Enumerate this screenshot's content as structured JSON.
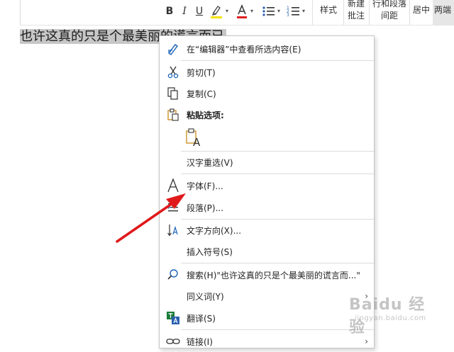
{
  "toolbar": {
    "bold_label": "B",
    "italic_label": "I",
    "underline_label": "U",
    "highlight_color": "#f5e211",
    "font_color": "#e02020",
    "style_label": "样式",
    "new_comment_line1": "新建",
    "new_comment_line2": "批注",
    "line_spacing_line1": "行和段落",
    "line_spacing_line2": "间距",
    "center_label": "居中",
    "justify_label": "两端"
  },
  "document": {
    "selected_text": "也许这真的只是个最美丽的谎言而已"
  },
  "context_menu": {
    "items": [
      {
        "label": "在“编辑器”中查看所选内容(E)",
        "icon": "editor-pen-icon"
      },
      {
        "label": "剪切(T)",
        "icon": "scissors-icon"
      },
      {
        "label": "复制(C)",
        "icon": "copy-icon"
      },
      {
        "label": "粘贴选项:",
        "icon": "clipboard-icon"
      },
      {
        "label": "汉字重选(V)",
        "icon": ""
      },
      {
        "label": "字体(F)...",
        "icon": "font-icon"
      },
      {
        "label": "段落(P)...",
        "icon": "paragraph-icon"
      },
      {
        "label": "文字方向(X)...",
        "icon": "text-direction-icon"
      },
      {
        "label": "插入符号(S)",
        "icon": ""
      },
      {
        "label": "搜索(H)\"也许这真的只是个最美丽的谎言而...\"",
        "icon": "search-icon"
      },
      {
        "label": "同义词(Y)",
        "icon": "",
        "submenu": true
      },
      {
        "label": "翻译(S)",
        "icon": "translate-icon"
      },
      {
        "label": "链接(I)",
        "icon": "link-icon",
        "submenu": true
      }
    ],
    "submenu_arrow": "›",
    "paste_option_letter": "A"
  },
  "annotation": {
    "arrow_color": "#e0191b"
  },
  "watermark": {
    "main": "Baidu 经验",
    "sub": "jingyan.baidu.com"
  }
}
